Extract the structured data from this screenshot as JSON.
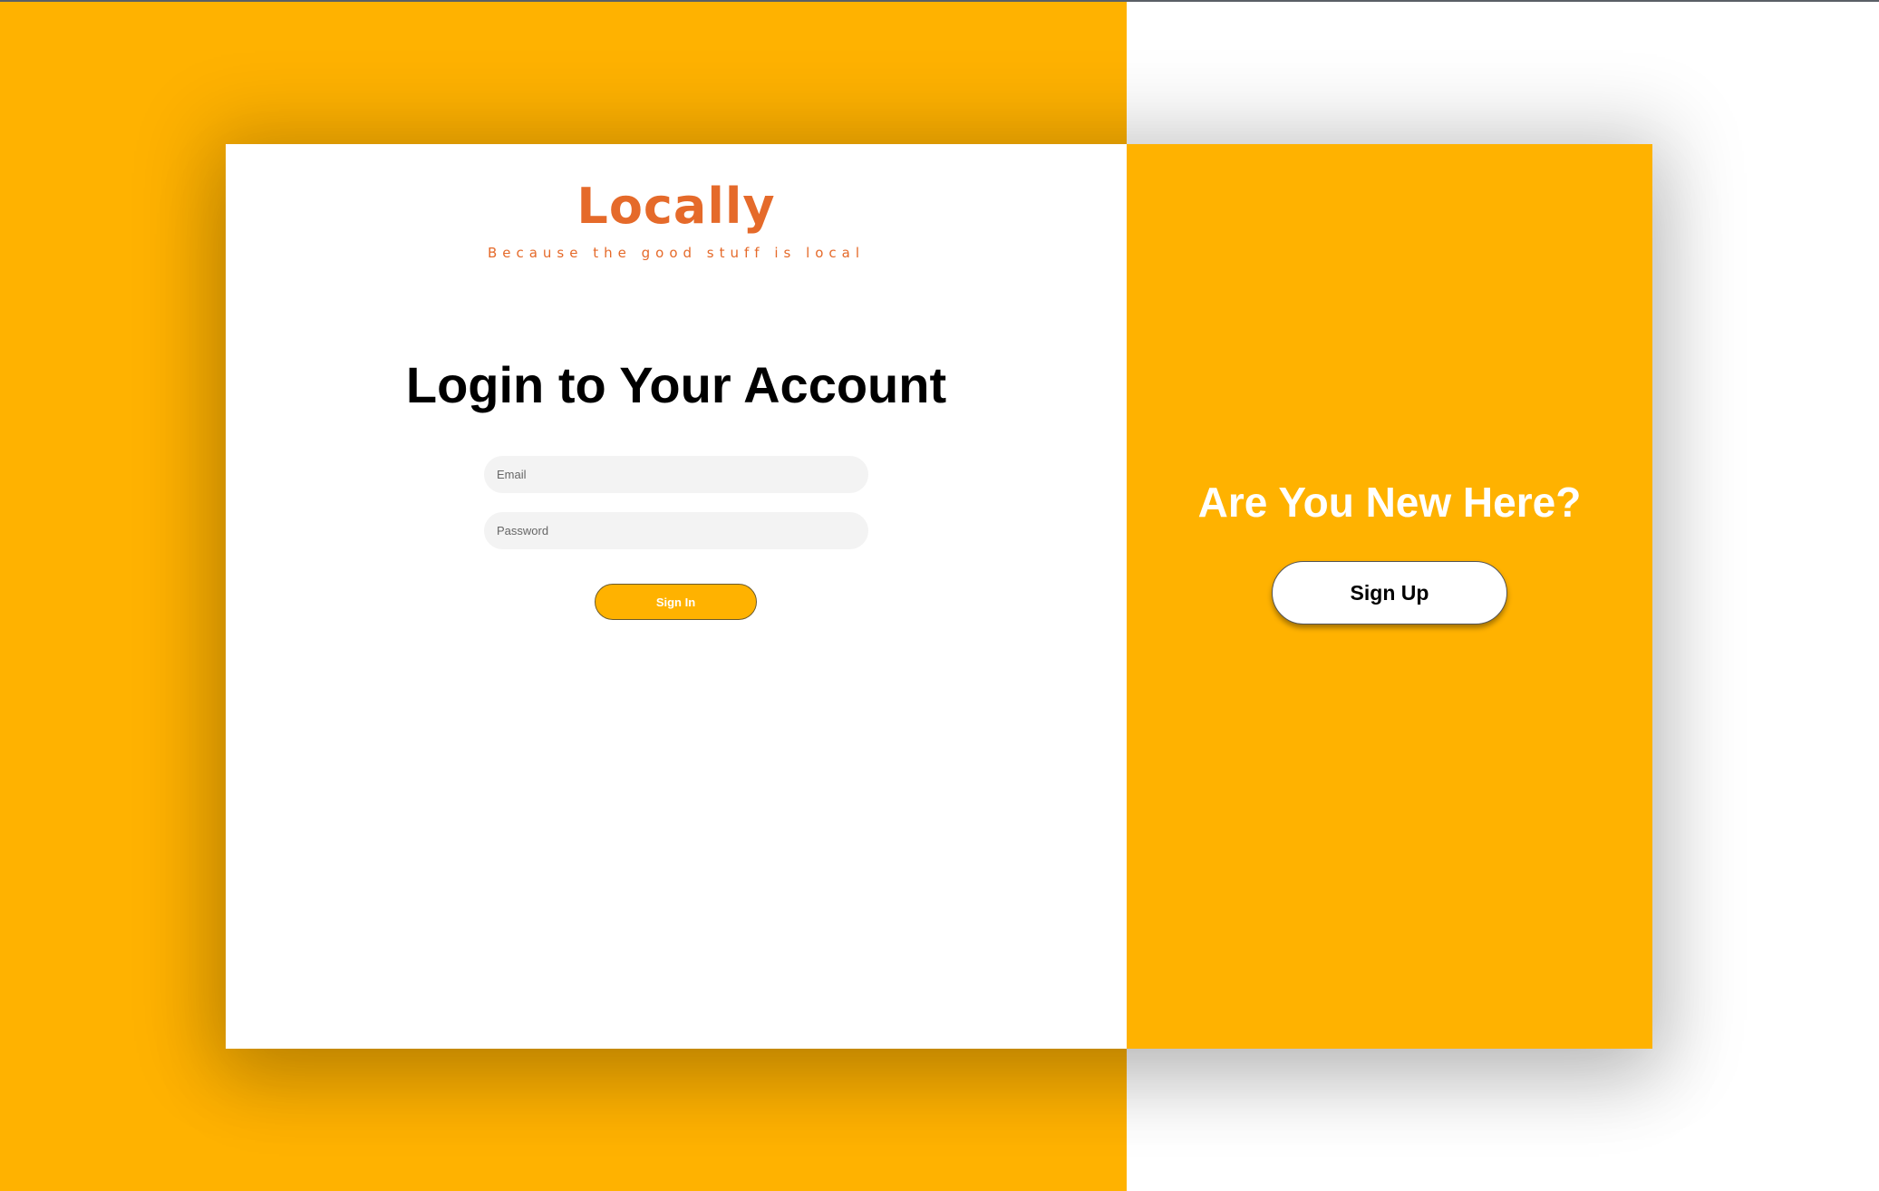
{
  "colors": {
    "accent": "#ffb200",
    "brand": "#e56a2a",
    "input_background": "#f3f3f3"
  },
  "brand": {
    "name": "Locally",
    "tagline": "Because the good stuff is local"
  },
  "login": {
    "heading": "Login to Your Account",
    "email_placeholder": "Email",
    "email_value": "",
    "password_placeholder": "Password",
    "password_value": "",
    "signin_label": "Sign In"
  },
  "signup": {
    "heading": "Are You New Here?",
    "button_label": "Sign Up"
  }
}
